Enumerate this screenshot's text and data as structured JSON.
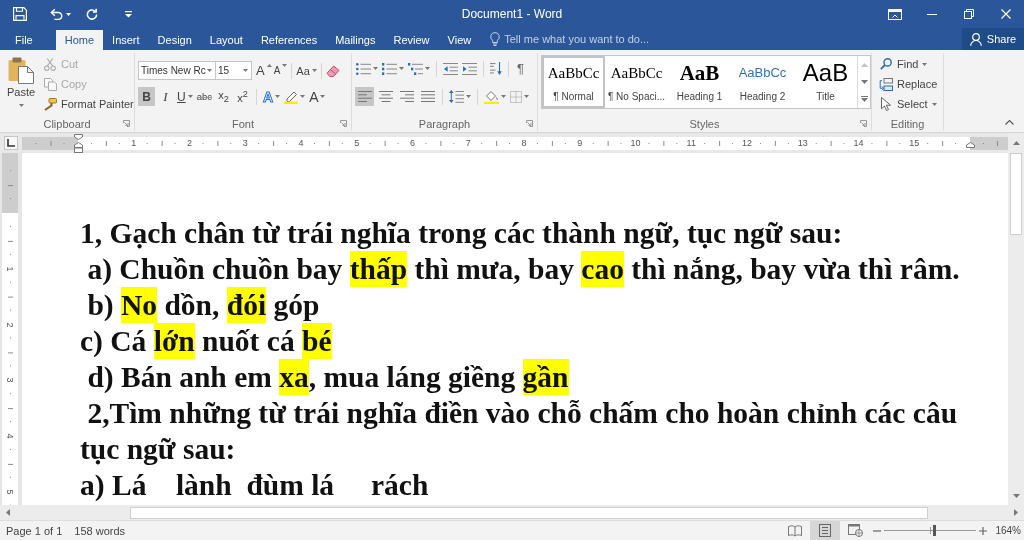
{
  "window": {
    "title": "Document1 - Word"
  },
  "tabs": [
    {
      "label": "File",
      "selected": false
    },
    {
      "label": "Home",
      "selected": true
    },
    {
      "label": "Insert",
      "selected": false
    },
    {
      "label": "Design",
      "selected": false
    },
    {
      "label": "Layout",
      "selected": false
    },
    {
      "label": "References",
      "selected": false
    },
    {
      "label": "Mailings",
      "selected": false
    },
    {
      "label": "Review",
      "selected": false
    },
    {
      "label": "View",
      "selected": false
    }
  ],
  "tell_me": {
    "placeholder": "Tell me what you want to do..."
  },
  "share": {
    "label": "Share"
  },
  "ribbon": {
    "clipboard": {
      "label": "Clipboard",
      "paste": {
        "label": "Paste"
      },
      "commands": [
        {
          "kind": "cut",
          "label": "Cut",
          "disabled": true
        },
        {
          "kind": "copy",
          "label": "Copy",
          "disabled": true
        },
        {
          "kind": "format_painter",
          "label": "Format Painter",
          "disabled": false
        }
      ]
    },
    "font": {
      "label": "Font",
      "font_name": "Times New Rc",
      "font_size": "15",
      "grow": "A",
      "shrink": "A",
      "change_case": "Aa",
      "formats": [
        {
          "kind": "bold",
          "label": "B",
          "selected": true
        },
        {
          "kind": "italic",
          "label": "I",
          "selected": false
        },
        {
          "kind": "underline",
          "label": "U",
          "selected": false
        },
        {
          "kind": "strikethrough",
          "label": "abc",
          "selected": false
        },
        {
          "kind": "subscript",
          "label": "x$_{2}$",
          "selected": false
        },
        {
          "kind": "superscript",
          "label": "x$^{2}$",
          "selected": false
        }
      ],
      "text_effects": "A",
      "font_color": "A"
    },
    "paragraph": {
      "label": "Paragraph",
      "show_marks": "¶",
      "alignment": [
        {
          "kind": "left",
          "selected": true
        },
        {
          "kind": "center",
          "selected": false
        },
        {
          "kind": "right",
          "selected": false
        },
        {
          "kind": "justify",
          "selected": false
        }
      ]
    },
    "styles": {
      "label": "Styles",
      "items": [
        {
          "kind": "normal",
          "preview": "AaBbCc",
          "name": "¶ Normal",
          "selected": true
        },
        {
          "kind": "no_spacing",
          "preview": "AaBbCc",
          "name": "¶ No Spaci...",
          "selected": false
        },
        {
          "kind": "heading1",
          "preview": "AaB",
          "name": "Heading 1",
          "selected": false
        },
        {
          "kind": "heading2",
          "preview": "AaBbCc",
          "name": "Heading 2",
          "selected": false
        },
        {
          "kind": "title",
          "preview": "AaB",
          "name": "Title",
          "selected": false
        }
      ]
    },
    "editing": {
      "label": "Editing",
      "commands": [
        {
          "kind": "find",
          "label": "Find"
        },
        {
          "kind": "replace",
          "label": "Replace"
        },
        {
          "kind": "select",
          "label": "Select"
        }
      ]
    }
  },
  "ruler": {
    "numbers": [
      "1",
      "2",
      "3",
      "4",
      "5",
      "6",
      "7",
      "8",
      "9",
      "10",
      "11",
      "12",
      "13",
      "14",
      "15"
    ]
  },
  "vertical_ruler": {
    "numbers": [
      "1",
      "2",
      "3",
      "4",
      "5"
    ]
  },
  "document": {
    "paragraphs": [
      {
        "runs": [
          {
            "text": "1, Gạch chân từ trái nghĩa trong các thành ngữ, tục ngữ sau:",
            "highlighted": false
          }
        ]
      },
      {
        "runs": [
          {
            "text": " a) Chuồn chuồn bay ",
            "highlighted": false
          },
          {
            "text": "thấp",
            "highlighted": true
          },
          {
            "text": " thì mưa, bay ",
            "highlighted": false
          },
          {
            "text": "cao",
            "highlighted": true
          },
          {
            "text": " thì nắng, bay vừa thì râm.",
            "highlighted": false
          }
        ]
      },
      {
        "runs": [
          {
            "text": " b) ",
            "highlighted": false
          },
          {
            "text": "No",
            "highlighted": true
          },
          {
            "text": " dồn, ",
            "highlighted": false
          },
          {
            "text": "đói",
            "highlighted": true
          },
          {
            "text": " góp",
            "highlighted": false
          }
        ]
      },
      {
        "runs": [
          {
            "text": "c) Cá ",
            "highlighted": false
          },
          {
            "text": "lớn",
            "highlighted": true
          },
          {
            "text": " nuốt cá ",
            "highlighted": false
          },
          {
            "text": "bé",
            "highlighted": true
          }
        ]
      },
      {
        "runs": [
          {
            "text": " d) Bán anh em ",
            "highlighted": false
          },
          {
            "text": "xa",
            "highlighted": true
          },
          {
            "text": ", mua láng giềng ",
            "highlighted": false
          },
          {
            "text": "gần",
            "highlighted": true
          }
        ]
      },
      {
        "runs": [
          {
            "text": " 2,Tìm những từ trái nghĩa điền vào chỗ chấm cho hoàn chỉnh các câu tục ngữ sau:",
            "highlighted": false
          }
        ]
      },
      {
        "runs": [
          {
            "text": "a) Lá    lành  đùm lá     rách",
            "highlighted": false
          }
        ]
      }
    ]
  },
  "status_bar": {
    "page": "Page 1 of 1",
    "words": "158 words",
    "view_modes": [
      {
        "kind": "read",
        "selected": false
      },
      {
        "kind": "print",
        "selected": true
      },
      {
        "kind": "web",
        "selected": false
      }
    ],
    "zoom": {
      "level": 0.54,
      "reading": "164%"
    }
  }
}
